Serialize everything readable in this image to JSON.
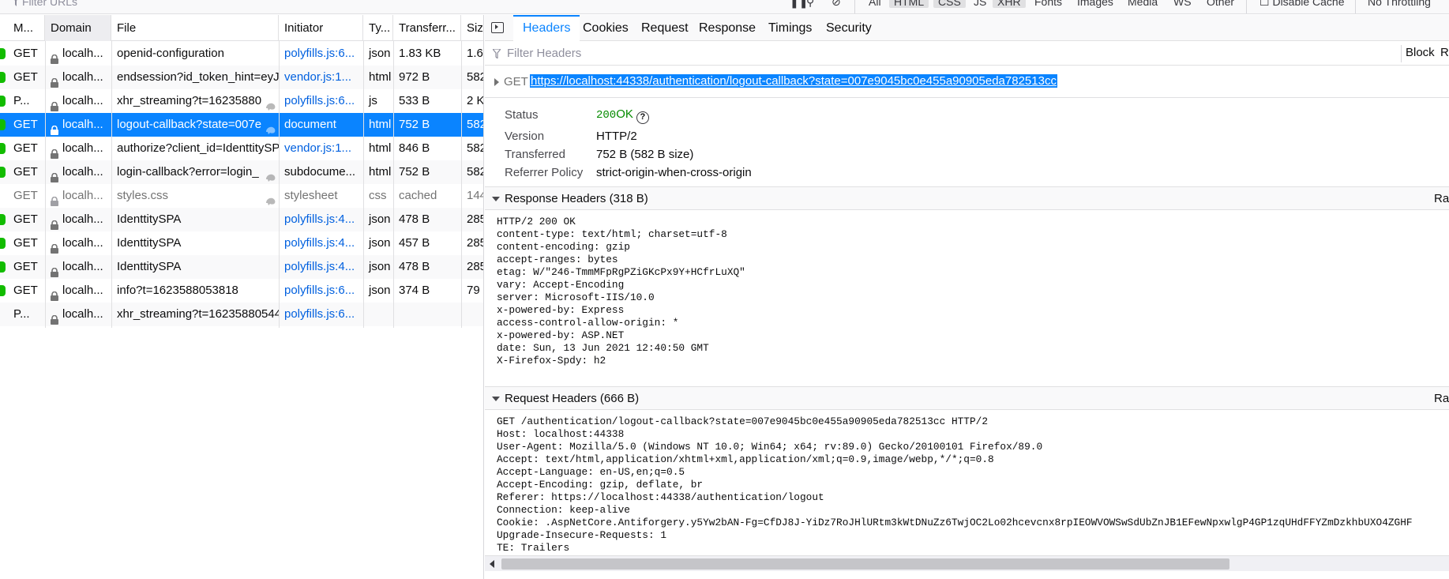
{
  "toolbar": {
    "filter_urls_placeholder": "Filter URLs",
    "type_filters": [
      "All",
      "HTML",
      "CSS",
      "JS",
      "XHR",
      "Fonts",
      "Images",
      "Media",
      "WS",
      "Other"
    ],
    "active_type_filters": [
      "HTML",
      "CSS",
      "XHR"
    ],
    "disable_cache_label": "Disable Cache",
    "throttling_label": "No Throttling"
  },
  "table": {
    "columns": [
      "M...",
      "Domain",
      "File",
      "Initiator",
      "Ty...",
      "Transferr...",
      "Siz"
    ],
    "rows": [
      {
        "method": "GET",
        "domain": "localh...",
        "file": "openid-configuration",
        "initiator": "polyfills.js:6...",
        "type": "json",
        "transferred": "1.83 KB",
        "size": "1.6",
        "status": "green"
      },
      {
        "method": "GET",
        "domain": "localh...",
        "file": "endsession?id_token_hint=eyJh",
        "initiator": "vendor.js:1...",
        "type": "html",
        "transferred": "972 B",
        "size": "582",
        "status": "green"
      },
      {
        "method": "P...",
        "domain": "localh...",
        "file": "xhr_streaming?t=16235880",
        "initiator": "polyfills.js:6...",
        "type": "js",
        "transferred": "533 B",
        "size": "2 K",
        "status": "green",
        "tracker": true
      },
      {
        "method": "GET",
        "domain": "localh...",
        "file": "logout-callback?state=007e",
        "initiator": "document",
        "type": "html",
        "transferred": "752 B",
        "size": "582",
        "status": "green",
        "tracker": true,
        "selected": true
      },
      {
        "method": "GET",
        "domain": "localh...",
        "file": "authorize?client_id=IdenttitySP",
        "initiator": "vendor.js:1...",
        "type": "html",
        "transferred": "846 B",
        "size": "582",
        "status": "green"
      },
      {
        "method": "GET",
        "domain": "localh...",
        "file": "login-callback?error=login_",
        "initiator": "subdocume...",
        "type": "html",
        "transferred": "752 B",
        "size": "582",
        "status": "green",
        "tracker": true
      },
      {
        "method": "GET",
        "domain": "localh...",
        "file": "styles.css",
        "initiator": "stylesheet",
        "type": "css",
        "transferred": "cached",
        "size": "144",
        "status": "gray",
        "tracker": true,
        "muted": true
      },
      {
        "method": "GET",
        "domain": "localh...",
        "file": "IdenttitySPA",
        "initiator": "polyfills.js:4...",
        "type": "json",
        "transferred": "478 B",
        "size": "285",
        "status": "green"
      },
      {
        "method": "GET",
        "domain": "localh...",
        "file": "IdenttitySPA",
        "initiator": "polyfills.js:4...",
        "type": "json",
        "transferred": "457 B",
        "size": "285",
        "status": "green"
      },
      {
        "method": "GET",
        "domain": "localh...",
        "file": "IdenttitySPA",
        "initiator": "polyfills.js:4...",
        "type": "json",
        "transferred": "478 B",
        "size": "285",
        "status": "green"
      },
      {
        "method": "GET",
        "domain": "localh...",
        "file": "info?t=1623588053818",
        "initiator": "polyfills.js:6...",
        "type": "json",
        "transferred": "374 B",
        "size": "79",
        "status": "green"
      },
      {
        "method": "P...",
        "domain": "localh...",
        "file": "xhr_streaming?t=16235880544",
        "initiator": "polyfills.js:6...",
        "type": "",
        "transferred": "",
        "size": "",
        "status": "none"
      }
    ]
  },
  "details": {
    "tabs": [
      "Headers",
      "Cookies",
      "Request",
      "Response",
      "Timings",
      "Security"
    ],
    "active_tab": "Headers",
    "filter_headers_placeholder": "Filter Headers",
    "block_label": "Block",
    "resend_label": "Re",
    "request_method": "GET",
    "request_url": "https://localhost:44338/authentication/logout-callback?state=007e9045bc0e455a90905eda782513cc",
    "summary": [
      {
        "key": "Status",
        "value": ""
      },
      {
        "key": "Version",
        "value": "HTTP/2"
      },
      {
        "key": "Transferred",
        "value": "752 B (582 B size)"
      },
      {
        "key": "Referrer Policy",
        "value": "strict-origin-when-cross-origin"
      }
    ],
    "status_code": "200",
    "status_text": "OK",
    "response_headers_title": "Response Headers (318 B)",
    "request_headers_title": "Request Headers (666 B)",
    "raw_label": "Raw",
    "response_headers_raw": "HTTP/2 200 OK\ncontent-type: text/html; charset=utf-8\ncontent-encoding: gzip\naccept-ranges: bytes\netag: W/\"246-TmmMFpRgPZiGKcPx9Y+HCfrLuXQ\"\nvary: Accept-Encoding\nserver: Microsoft-IIS/10.0\nx-powered-by: Express\naccess-control-allow-origin: *\nx-powered-by: ASP.NET\ndate: Sun, 13 Jun 2021 12:40:50 GMT\nX-Firefox-Spdy: h2",
    "request_headers_raw": "GET /authentication/logout-callback?state=007e9045bc0e455a90905eda782513cc HTTP/2\nHost: localhost:44338\nUser-Agent: Mozilla/5.0 (Windows NT 10.0; Win64; x64; rv:89.0) Gecko/20100101 Firefox/89.0\nAccept: text/html,application/xhtml+xml,application/xml;q=0.9,image/webp,*/*;q=0.8\nAccept-Language: en-US,en;q=0.5\nAccept-Encoding: gzip, deflate, br\nReferer: https://localhost:44338/authentication/logout\nConnection: keep-alive\nCookie: .AspNetCore.Antiforgery.y5Yw2bAN-Fg=CfDJ8J-YiDz7RoJHlURtm3kWtDNuZz6TwjOC2Lo02hcevcnx8rpIEOWVOWSwSdUbZnJB1EFewNpxwlgP4GP1zqUHdFFYZmDzkhbUXO4ZGHF\nUpgrade-Insecure-Requests: 1\nTE: Trailers"
  },
  "colors": {
    "accent": "#0a84ff",
    "status_ok": "#12bc00",
    "link": "#0060df"
  }
}
